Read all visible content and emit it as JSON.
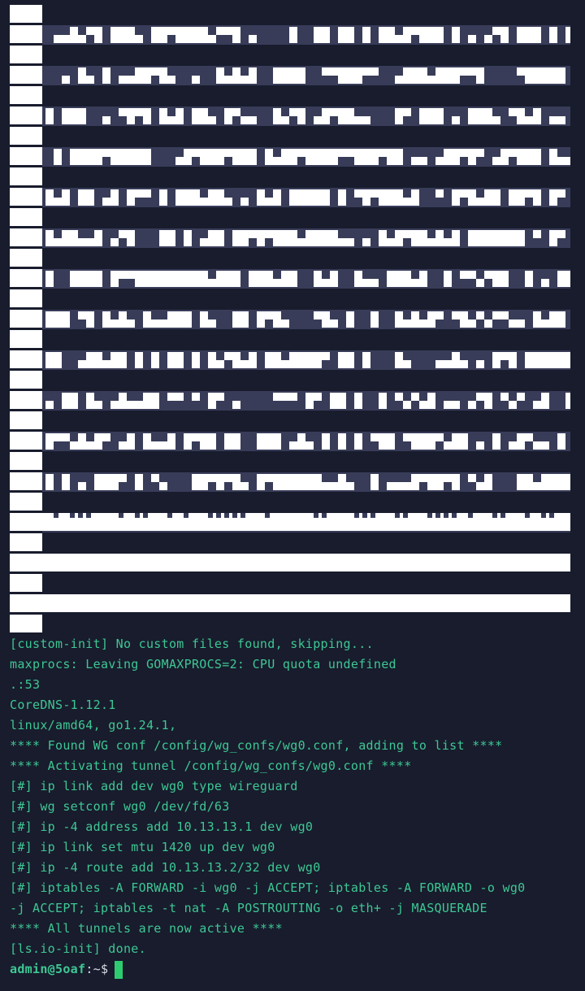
{
  "terminal": {
    "colors": {
      "background": "#181c2d",
      "text": "#3ec793",
      "qr_light": "#ffffff",
      "qr_stripe": "#383c58",
      "cursor": "#2ecc71"
    },
    "qr_code": {
      "description_icon": "qr-code-art"
    },
    "log_lines": [
      "[custom-init] No custom files found, skipping...",
      "maxprocs: Leaving GOMAXPROCS=2: CPU quota undefined",
      ".:53",
      "CoreDNS-1.12.1",
      "linux/amd64, go1.24.1,",
      "**** Found WG conf /config/wg_confs/wg0.conf, adding to list ****",
      "**** Activating tunnel /config/wg_confs/wg0.conf ****",
      "[#] ip link add dev wg0 type wireguard",
      "[#] wg setconf wg0 /dev/fd/63",
      "[#] ip -4 address add 10.13.13.1 dev wg0",
      "[#] ip link set mtu 1420 up dev wg0",
      "[#] ip -4 route add 10.13.13.2/32 dev wg0",
      "[#] iptables -A FORWARD -i wg0 -j ACCEPT; iptables -A FORWARD -o wg0",
      "-j ACCEPT; iptables -t nat -A POSTROUTING -o eth+ -j MASQUERADE",
      "**** All tunnels are now active ****",
      "[ls.io-init] done."
    ],
    "prompt": {
      "user_host": "admin@5oaf",
      "separator": ":",
      "path": "~",
      "symbol": "$"
    }
  }
}
